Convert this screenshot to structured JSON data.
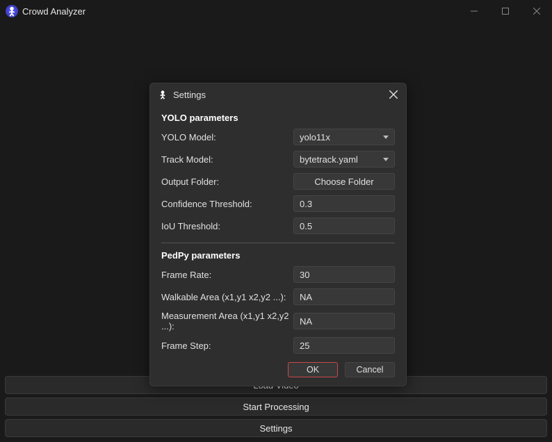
{
  "window": {
    "title": "Crowd Analyzer"
  },
  "dialog": {
    "title": "Settings",
    "section_yolo": "YOLO parameters",
    "section_pedpy": "PedPy parameters",
    "yolo_model_label": "YOLO Model:",
    "yolo_model_value": "yolo11x",
    "track_model_label": "Track Model:",
    "track_model_value": "bytetrack.yaml",
    "output_folder_label": "Output Folder:",
    "output_folder_button": "Choose Folder",
    "confidence_label": "Confidence Threshold:",
    "confidence_value": "0.3",
    "iou_label": "IoU Threshold:",
    "iou_value": "0.5",
    "frame_rate_label": "Frame Rate:",
    "frame_rate_value": "30",
    "walkable_label": "Walkable Area (x1,y1 x2,y2 ...):",
    "walkable_value": "NA",
    "measurement_label": "Measurement Area (x1,y1 x2,y2 ...):",
    "measurement_value": "NA",
    "frame_step_label": "Frame Step:",
    "frame_step_value": "25",
    "ok": "OK",
    "cancel": "Cancel"
  },
  "main_buttons": {
    "load_video": "Load Video",
    "start_processing": "Start Processing",
    "settings": "Settings"
  }
}
